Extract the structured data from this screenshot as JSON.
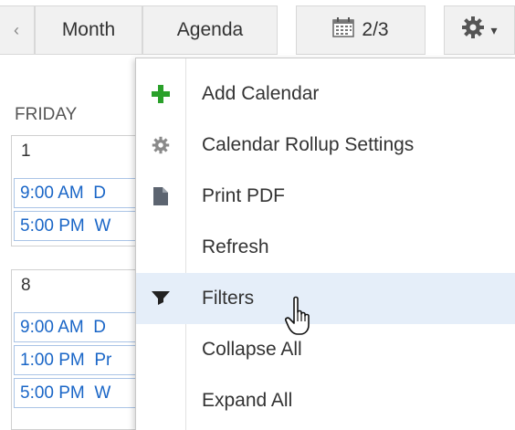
{
  "toolbar": {
    "prev_label": "‹",
    "month_label": "Month",
    "agenda_label": "Agenda",
    "date_label": "2/3",
    "date_icon": "calendar-icon",
    "settings_icon": "gear-icon",
    "settings_caret": "▾"
  },
  "calendar": {
    "day_header": "FRIDAY",
    "weeks": [
      {
        "day": "1",
        "events": [
          {
            "time": "9:00 AM",
            "title": "D"
          },
          {
            "time": "5:00 PM",
            "title": "W"
          }
        ]
      },
      {
        "day": "8",
        "events": [
          {
            "time": "9:00 AM",
            "title": "D"
          },
          {
            "time": "1:00 PM",
            "title": "Pr"
          },
          {
            "time": "5:00 PM",
            "title": "W"
          }
        ]
      }
    ]
  },
  "menu": {
    "items": [
      {
        "label": "Add Calendar",
        "icon": "plus-icon"
      },
      {
        "label": "Calendar Rollup Settings",
        "icon": "gear-icon"
      },
      {
        "label": "Print PDF",
        "icon": "document-icon"
      },
      {
        "label": "Refresh",
        "icon": ""
      },
      {
        "label": "Filters",
        "icon": "funnel-icon"
      },
      {
        "label": "Collapse All",
        "icon": ""
      },
      {
        "label": "Expand All",
        "icon": ""
      }
    ],
    "hovered_index": 4
  },
  "colors": {
    "accent_green": "#2aa02a",
    "event_blue": "#1a66c7",
    "hover_bg": "#e5eef9"
  }
}
